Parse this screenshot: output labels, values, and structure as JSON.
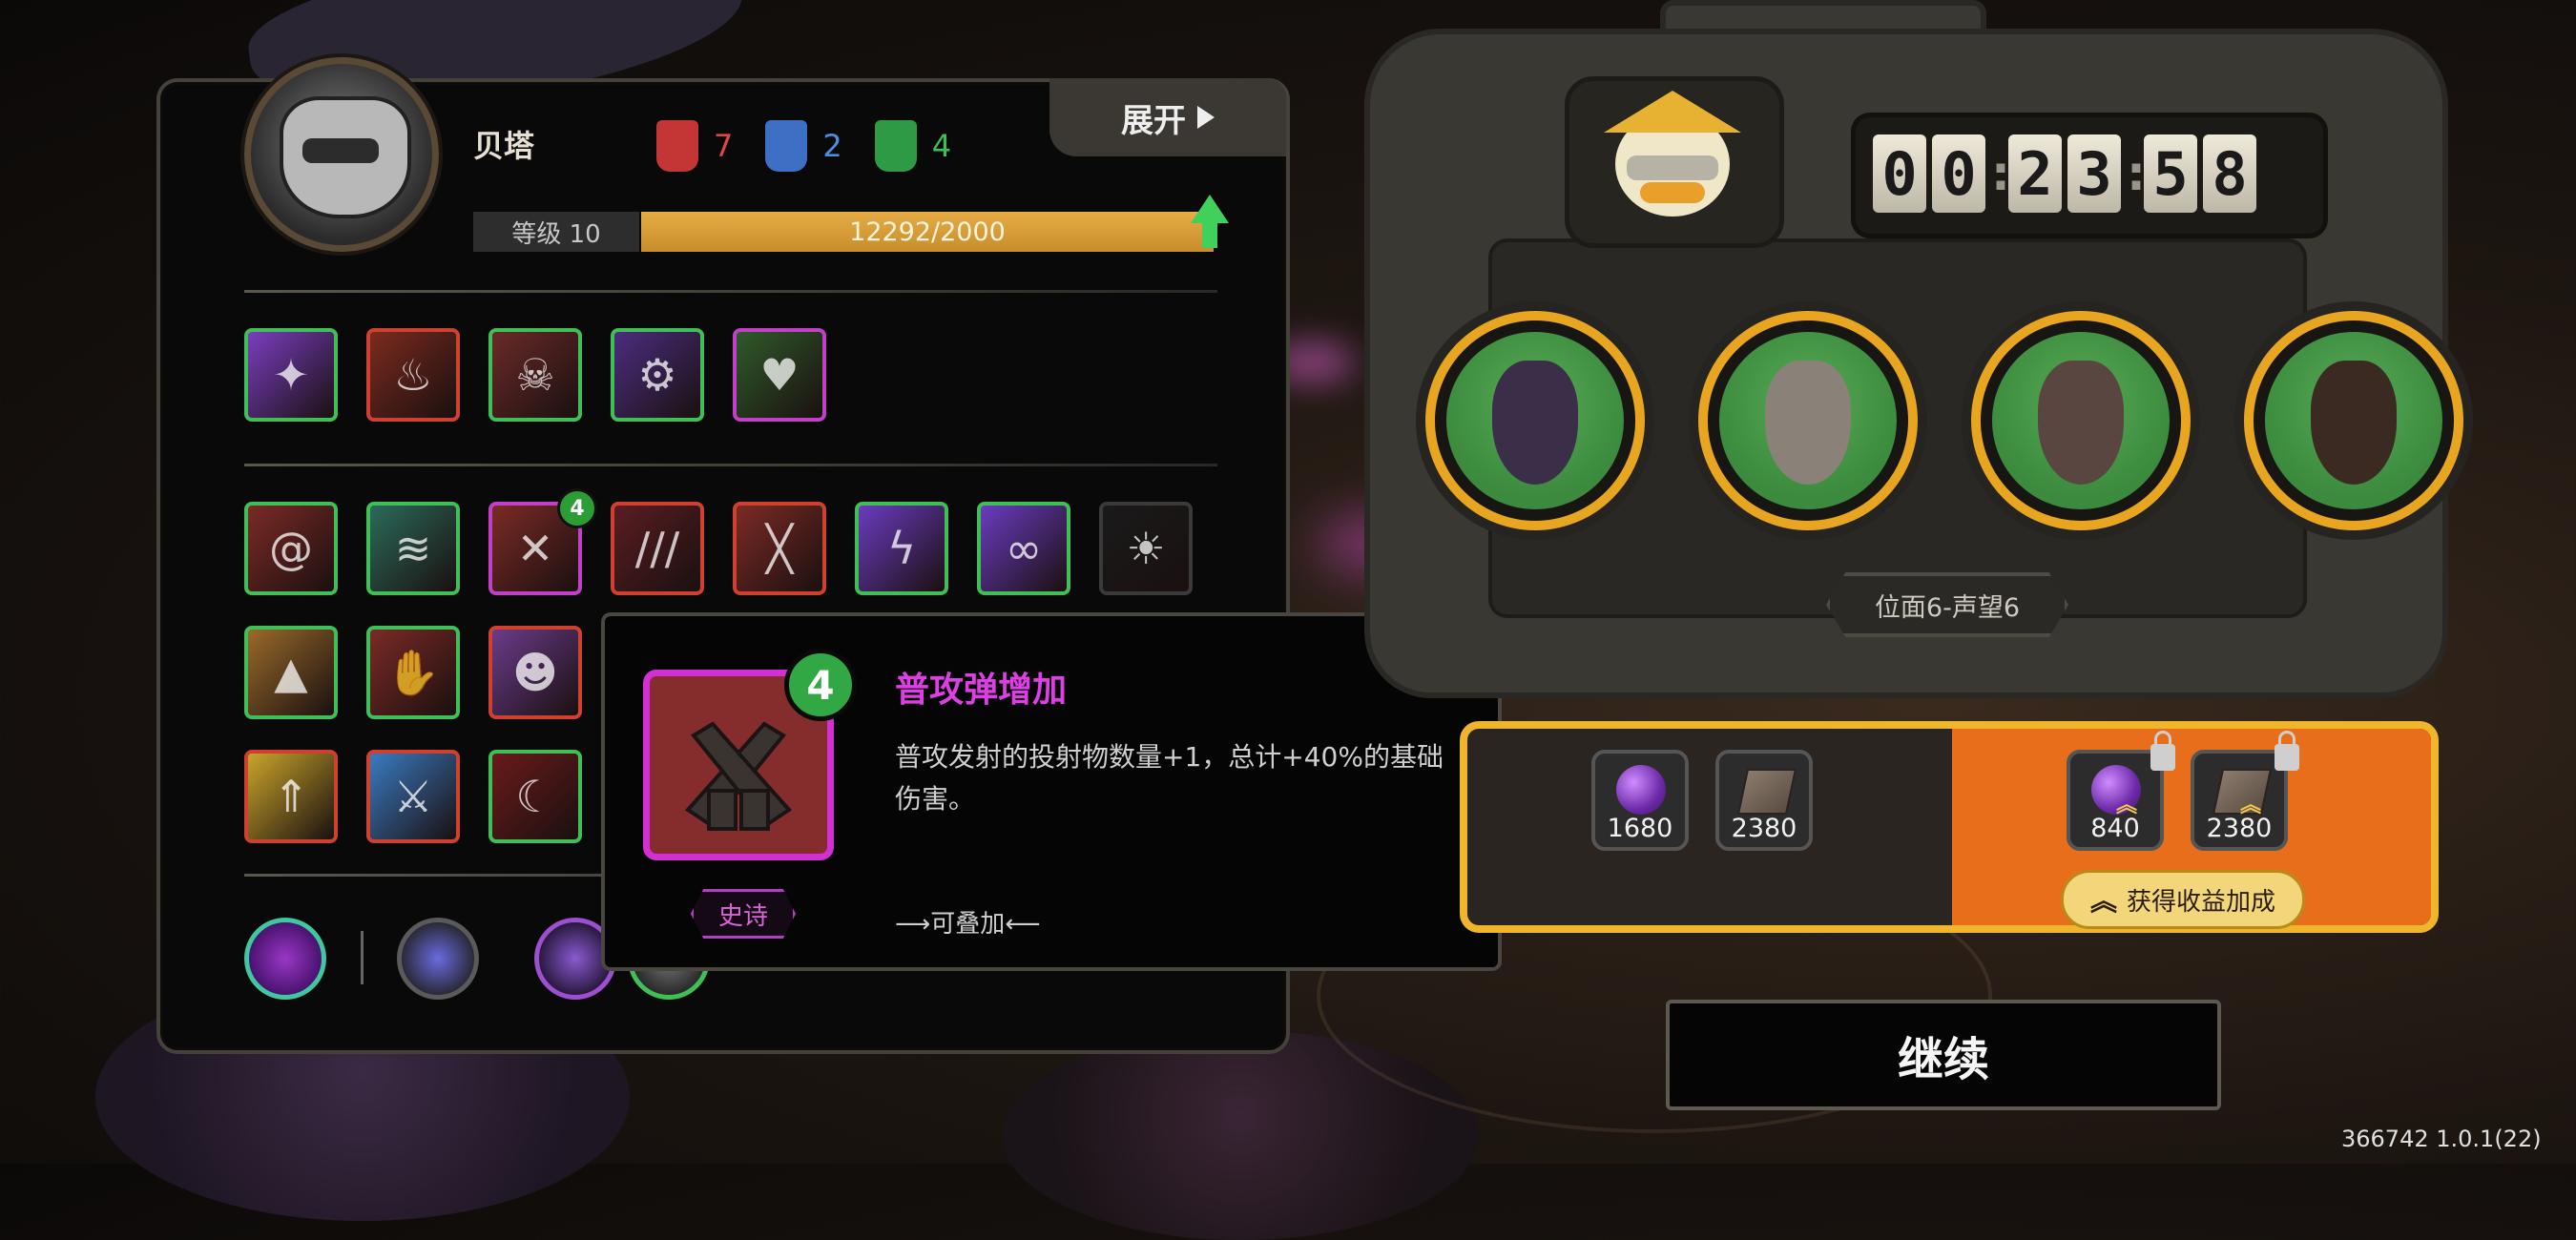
{
  "hero": {
    "name": "贝塔",
    "level_label": "等级 10",
    "xp_text": "12292/2000",
    "xp_progress": 1.0,
    "expand_label": "展开",
    "factions": [
      {
        "icon": "red-mask-icon",
        "count": "7",
        "color": "#e04646"
      },
      {
        "icon": "blue-mask-icon",
        "count": "2",
        "color": "#4a90e2"
      },
      {
        "icon": "green-mask-icon",
        "count": "4",
        "color": "#3fbf56"
      }
    ]
  },
  "equipment_row": [
    {
      "icon": "purple-claw-icon",
      "border": "#3fbf56",
      "bg": "#7a3ec0"
    },
    {
      "icon": "flame-icon",
      "border": "#d0402f",
      "bg": "#7b2a1e"
    },
    {
      "icon": "skull-icon",
      "border": "#3fbf56",
      "bg": "#6a2a28"
    },
    {
      "icon": "machine-icon",
      "border": "#3fbf56",
      "bg": "#4b2d80"
    },
    {
      "icon": "green-heart-icon",
      "border": "#c23fc8",
      "bg": "#2f5a2a"
    }
  ],
  "skill_grid": [
    {
      "icon": "spiral-icon",
      "border": "#3fbf56",
      "bg": "#7b2a25"
    },
    {
      "icon": "green-wave-icon",
      "border": "#3fbf56",
      "bg": "#2b6a5a"
    },
    {
      "icon": "crossed-pistols-icon",
      "border": "#c23fc8",
      "bg": "#7b2a25",
      "level": "4"
    },
    {
      "icon": "slash-claw-icon",
      "border": "#d0402f",
      "bg": "#5a1d22"
    },
    {
      "icon": "blue-slash-icon",
      "border": "#d0402f",
      "bg": "#7b2a25"
    },
    {
      "icon": "purple-lightning-icon",
      "border": "#3fbf56",
      "bg": "#6b3bc0"
    },
    {
      "icon": "purple-chain-icon",
      "border": "#3fbf56",
      "bg": "#6b3bc0"
    },
    {
      "icon": "sun-cloud-icon",
      "border": "#3a3a3a",
      "bg": "#1a1a1a"
    },
    {
      "icon": "rock-claw-icon",
      "border": "#3fbf56",
      "bg": "#9a6a2a"
    },
    {
      "icon": "hand-grab-icon",
      "border": "#3fbf56",
      "bg": "#7b2a25"
    },
    {
      "icon": "blue-mask-face-icon",
      "border": "#d0402f",
      "bg": "#6b3b8a"
    },
    {
      "icon": "green-arrow-burst-icon",
      "border": "#d0402f",
      "bg": "#c9a52a"
    },
    {
      "icon": "dagger-icon",
      "border": "#d0402f",
      "bg": "#3a7ac0"
    },
    {
      "icon": "shadow-beast-icon",
      "border": "#3fbf56",
      "bg": "#6a1a1a"
    }
  ],
  "tooltip": {
    "icon": "crossed-pistols-icon",
    "level": "4",
    "title": "普攻弹增加",
    "description": "普攻发射的投射物数量+1，总计+40%的基础伤害。",
    "rarity": "史诗",
    "stack_note": "⟶可叠加⟵"
  },
  "timer": {
    "digits": [
      "0",
      "0",
      "2",
      "3",
      "5",
      "8"
    ]
  },
  "party": [
    {
      "icon": "dark-crystal-hero-icon"
    },
    {
      "icon": "masked-warrior-hero-icon"
    },
    {
      "icon": "red-mech-hero-icon"
    },
    {
      "icon": "glasses-hero-icon"
    }
  ],
  "realm_label": "位面6-声望6",
  "rewards": {
    "base": [
      {
        "icon": "purple-orb-icon",
        "value": "1680"
      },
      {
        "icon": "book-icon",
        "value": "2380"
      }
    ],
    "bonus": [
      {
        "icon": "purple-orb-icon",
        "value": "840"
      },
      {
        "icon": "book-icon",
        "value": "2380"
      }
    ],
    "bonus_label": "获得收益加成"
  },
  "continue_label": "继续",
  "version": "366742 1.0.1(22)"
}
